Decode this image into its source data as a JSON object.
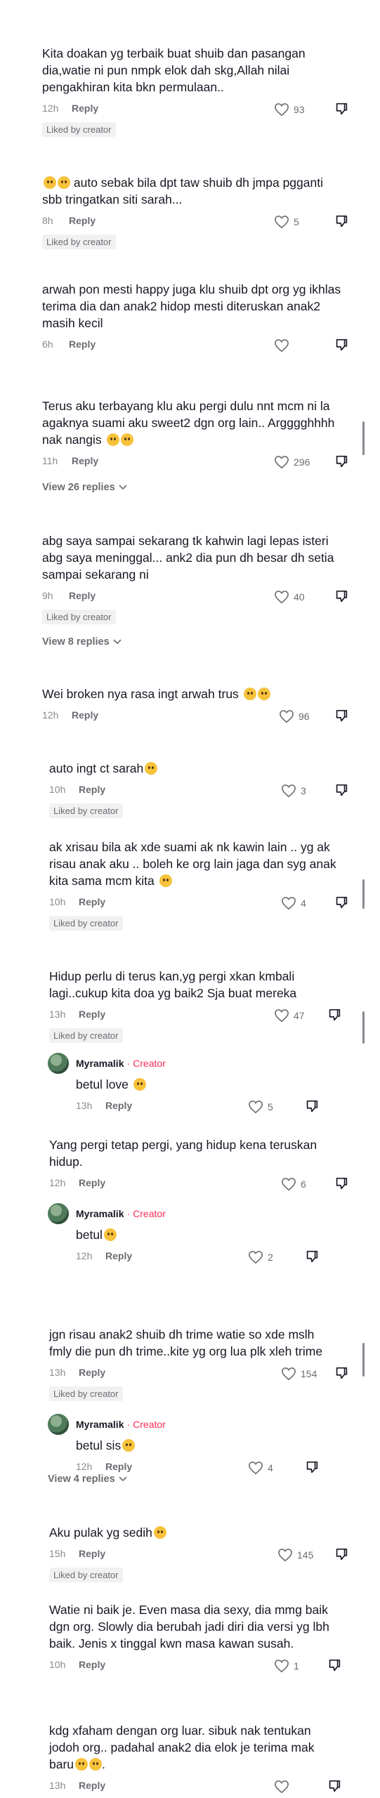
{
  "ui": {
    "reply_label": "Reply",
    "liked_by_creator": "Liked by creator"
  },
  "comments": [
    {
      "text": "Kita doakan yg terbaik buat shuib dan pasangan dia,watie ni pun nmpk elok dah skg,Allah nilai pengakhiran kita bkn permulaan..",
      "time": "12h",
      "likes": "93",
      "liked_by_creator": true
    },
    {
      "text": "auto sebak bila dpt taw shuib dh jmpa pgganti sbb tringatkan siti sarah...",
      "time": "8h",
      "likes": "5",
      "liked_by_creator": true
    },
    {
      "text": "arwah pon mesti happy juga klu shuib dpt org yg ikhlas terima dia dan anak2 hidop mesti diteruskan anak2 masih kecil",
      "time": "6h",
      "likes": "",
      "liked_by_creator": false
    },
    {
      "text": "Terus aku terbayang klu aku pergi dulu nnt mcm ni la agaknya suami aku sweet2 dgn org lain.. Arggggh​hhh nak nangis",
      "time": "11h",
      "likes": "296",
      "liked_by_creator": false,
      "view_replies": "View 26 replies"
    },
    {
      "text": "abg saya sampai sekarang tk kahwin lagi lepas isteri abg saya meninggal... ank2 dia pun dh besar dh setia sampai sekarang ni",
      "time": "9h",
      "likes": "40",
      "liked_by_creator": true,
      "view_replies": "View 8 replies"
    },
    {
      "text": "Wei broken nya rasa ingt arwah trus",
      "time": "12h",
      "likes": "96",
      "liked_by_creator": false
    },
    {
      "text": "auto ingt ct sarah",
      "time": "10h",
      "likes": "3",
      "liked_by_creator": true
    },
    {
      "text": "ak xrisau bila ak xde suami ak nk kawin lain .. yg ak risau anak aku .. boleh ke org lain jaga dan syg anak kita sama mcm kita",
      "time": "10h",
      "likes": "4",
      "liked_by_creator": true
    },
    {
      "text": "Hidup perlu di terus kan,yg pergi xkan kmbali lagi..cukup kita doa yg baik2 Sja buat mereka",
      "time": "13h",
      "likes": "47",
      "liked_by_creator": true
    },
    {
      "text": "Yang pergi tetap pergi, yang hidup kena teruskan hidup.",
      "time": "12h",
      "likes": "6",
      "liked_by_creator": false
    },
    {
      "text": "jgn risau anak2 shuib dh trime watie so xde mslh fmly die pun dh trime..kite yg org lua plk xleh trime",
      "time": "13h",
      "likes": "154",
      "liked_by_creator": true,
      "view_replies": "View 4 replies"
    },
    {
      "text": "Aku pulak yg sedih",
      "time": "15h",
      "likes": "145",
      "liked_by_creator": true
    },
    {
      "text": "Watie ni baik je. Even masa dia sexy, dia mmg baik dgn org. Slowly dia berubah jadi diri dia versi yg lbh baik. Jenis x tinggal kwn masa kawan susah.",
      "time": "10h",
      "likes": "1",
      "liked_by_creator": false
    },
    {
      "text": "kdg xfaham dengan org luar. sibuk nak tentukan jodoh org.. padahal anak2 dia elok je terima mak baru",
      "time": "13h",
      "likes": "",
      "liked_by_creator": false
    }
  ],
  "replies": [
    {
      "name": "Myramalik",
      "badge": "Creator",
      "text": "betul love",
      "time": "13h",
      "likes": "5"
    },
    {
      "name": "Myramalik",
      "badge": "Creator",
      "text": "betul",
      "time": "12h",
      "likes": "2"
    },
    {
      "name": "Myramalik",
      "badge": "Creator",
      "text": "betul sis",
      "time": "12h",
      "likes": "4"
    }
  ]
}
